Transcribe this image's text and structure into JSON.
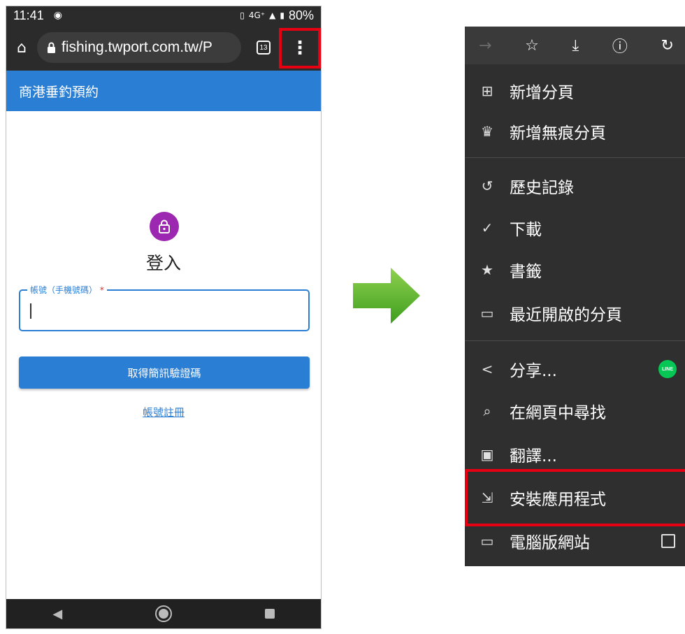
{
  "status_bar": {
    "time": "11:41",
    "signal": "4G⁺",
    "battery": "80%"
  },
  "browser": {
    "url": "fishing.twport.com.tw/P",
    "tab_count": "13"
  },
  "app": {
    "title": "商港垂釣預約",
    "login_title": "登入",
    "account_label": "帳號（手機號碼）",
    "required_mark": "*",
    "sms_button": "取得簡訊驗證碼",
    "register_link": "帳號註冊"
  },
  "menu": {
    "items": [
      {
        "label": "新增分頁",
        "icon": "plus-box-icon"
      },
      {
        "label": "新增無痕分頁",
        "icon": "incognito-icon"
      },
      {
        "label": "歷史記錄",
        "icon": "history-icon"
      },
      {
        "label": "下載",
        "icon": "download-done-icon"
      },
      {
        "label": "書籤",
        "icon": "star-icon"
      },
      {
        "label": "最近開啟的分頁",
        "icon": "devices-icon"
      },
      {
        "label": "分享...",
        "icon": "share-icon"
      },
      {
        "label": "在網頁中尋找",
        "icon": "find-in-page-icon"
      },
      {
        "label": "翻譯...",
        "icon": "translate-icon"
      },
      {
        "label": "安裝應用程式",
        "icon": "install-app-icon"
      },
      {
        "label": "電腦版網站",
        "icon": "desktop-icon"
      }
    ],
    "line_badge": "LINE"
  },
  "colors": {
    "highlight": "#e60012",
    "brand_blue": "#2a7fd5",
    "avatar_purple": "#9c27b0",
    "arrow_green": "#5cb82e"
  }
}
